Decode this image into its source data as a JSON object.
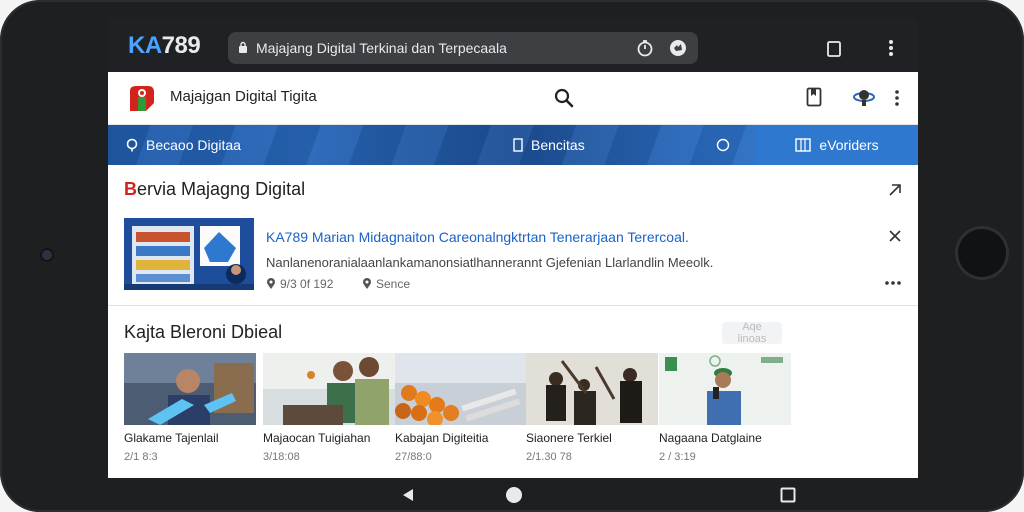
{
  "browser": {
    "brand_left": "KA",
    "brand_right": "789",
    "url_text": "Majajang Digital Terkinai dan Terpecaala"
  },
  "site": {
    "title": "Majajgan Digital Tigita"
  },
  "nav": {
    "items": [
      "Becaoo Digitaa",
      "Bencitas",
      "",
      "eVoriders"
    ]
  },
  "news_section": {
    "title_initial": "B",
    "title_rest": "ervia Majagng Digital",
    "article": {
      "title": "KA789 Marian Midagnaiton Careonalngktrtan Tenerarjaan Terercoal.",
      "description": "Nanlanenoranialaanlankamanonsiatlhannerannt Gjefenian Llarlandlin Meeolk.",
      "meta_date": "9/3 0f 192",
      "meta_source": "Sence"
    }
  },
  "video_section": {
    "title": "Kajta Bleroni Dbieal",
    "button_label": "Aqe linoas",
    "cards": [
      {
        "title": "Glakame Tajenlail",
        "meta": "2/1 8:3"
      },
      {
        "title": "Majaocan Tuigiahan",
        "meta": "3/18:08"
      },
      {
        "title": "Kabajan Digiteitia",
        "meta": "27/88:0"
      },
      {
        "title": "Siaonere Terkiel",
        "meta": "2/1.30 78"
      },
      {
        "title": "Nagaana Datglaine",
        "meta": "2 / 3:19"
      }
    ]
  },
  "colors": {
    "accent_blue": "#1a62c6",
    "nav_blue": "#2766b8",
    "brand_red": "#d3231c",
    "chrome_dark": "#202124"
  }
}
